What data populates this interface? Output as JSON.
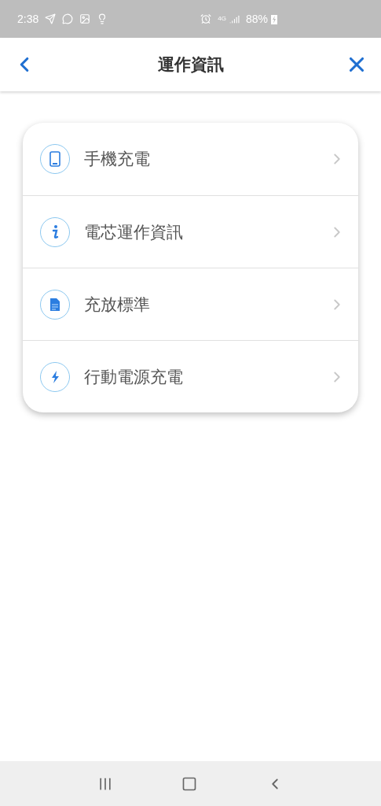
{
  "status_bar": {
    "time": "2:38",
    "network": "4G",
    "battery": "88%"
  },
  "header": {
    "title": "運作資訊"
  },
  "menu": [
    {
      "label": "手機充電",
      "kind": "phone"
    },
    {
      "label": "電芯運作資訊",
      "kind": "info"
    },
    {
      "label": "充放標準",
      "kind": "document"
    },
    {
      "label": "行動電源充電",
      "kind": "bolt"
    }
  ]
}
